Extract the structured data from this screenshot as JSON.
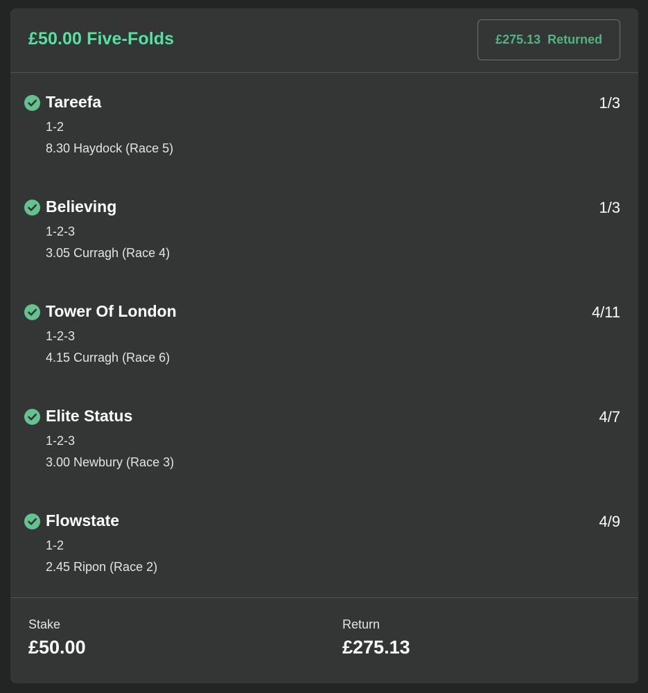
{
  "bet": {
    "title": "£50.00 Five-Folds",
    "returned_amount": "£275.13",
    "returned_label": "Returned"
  },
  "selections": [
    {
      "name": "Tareefa",
      "odds": "1/3",
      "market": "1-2",
      "event": "8.30 Haydock (Race 5)",
      "status_icon": "check-circle-icon"
    },
    {
      "name": "Believing",
      "odds": "1/3",
      "market": "1-2-3",
      "event": "3.05 Curragh (Race 4)",
      "status_icon": "check-circle-icon"
    },
    {
      "name": "Tower Of London",
      "odds": "4/11",
      "market": "1-2-3",
      "event": "4.15 Curragh (Race 6)",
      "status_icon": "check-circle-icon"
    },
    {
      "name": "Elite Status",
      "odds": "4/7",
      "market": "1-2-3",
      "event": "3.00 Newbury (Race 3)",
      "status_icon": "check-circle-icon"
    },
    {
      "name": "Flowstate",
      "odds": "4/9",
      "market": "1-2",
      "event": "2.45 Ripon (Race 2)",
      "status_icon": "check-circle-icon"
    }
  ],
  "footer": {
    "stake_label": "Stake",
    "stake_value": "£50.00",
    "return_label": "Return",
    "return_value": "£275.13"
  },
  "colors": {
    "accent_green": "#54e2a0",
    "returned_green": "#4fb583",
    "check_green": "#63c38f",
    "card_background": "#333635",
    "page_background": "#232424"
  }
}
